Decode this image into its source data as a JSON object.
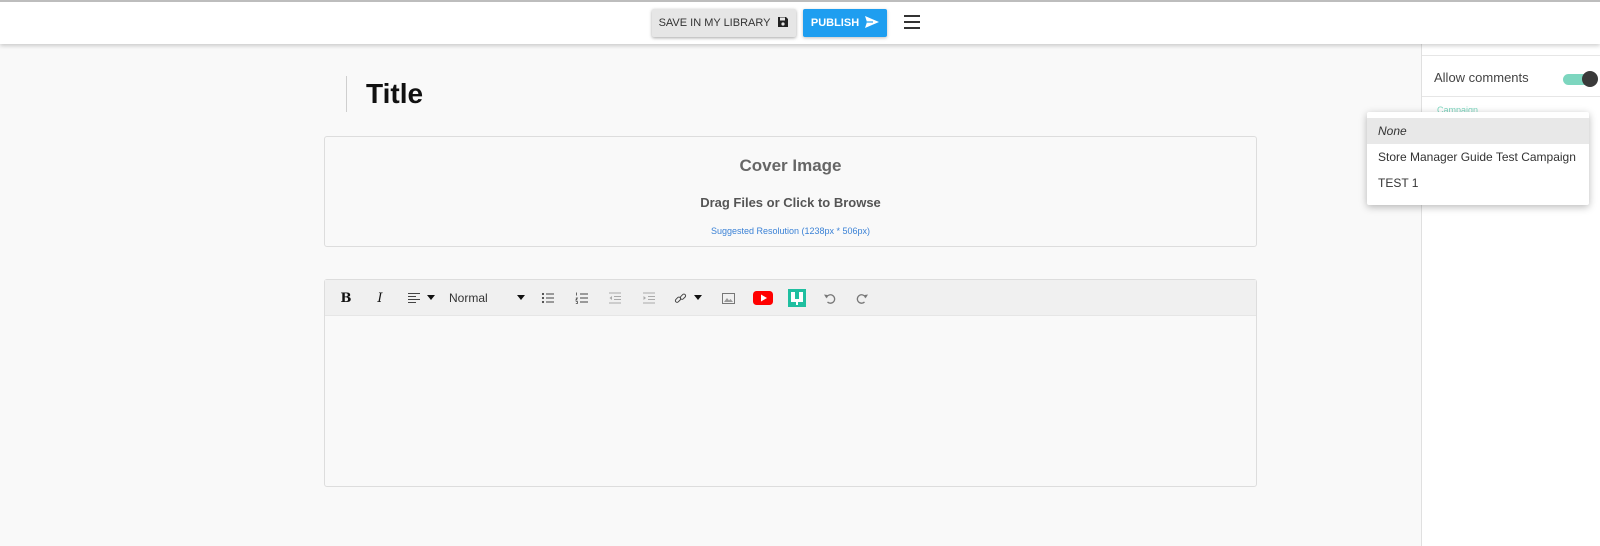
{
  "header": {
    "save_label": "SAVE IN MY LIBRARY",
    "save_icon": "floppy-disk-icon",
    "publish_label": "PUBLISH",
    "publish_icon": "send-icon",
    "menu_icon": "hamburger-menu-icon",
    "publish_color": "#1e9ef0"
  },
  "post": {
    "title_placeholder": "Title"
  },
  "cover": {
    "title": "Cover Image",
    "drag_text": "Drag Files or Click to Browse",
    "hint": "Suggested Resolution (1238px * 506px)"
  },
  "editor": {
    "format_value": "Normal",
    "tools": [
      "bold-icon",
      "italic-icon",
      "align-icon",
      "format-select",
      "bullet-list-icon",
      "numbered-list-icon",
      "outdent-icon",
      "indent-icon",
      "link-icon",
      "image-icon",
      "youtube-icon",
      "embed-app-icon",
      "undo-icon",
      "redo-icon"
    ],
    "youtube_color": "#ff0000",
    "embed_color": "#1fbfa0"
  },
  "sidebar": {
    "allow_comments_label": "Allow comments",
    "allow_comments_on": true,
    "campaign_label": "Campaign",
    "toggle_color": "#7dd6bf"
  },
  "dropdown": {
    "options": [
      {
        "label": "None",
        "selected": true
      },
      {
        "label": "Store Manager Guide Test Campaign",
        "selected": false
      },
      {
        "label": "TEST 1",
        "selected": false
      }
    ]
  }
}
